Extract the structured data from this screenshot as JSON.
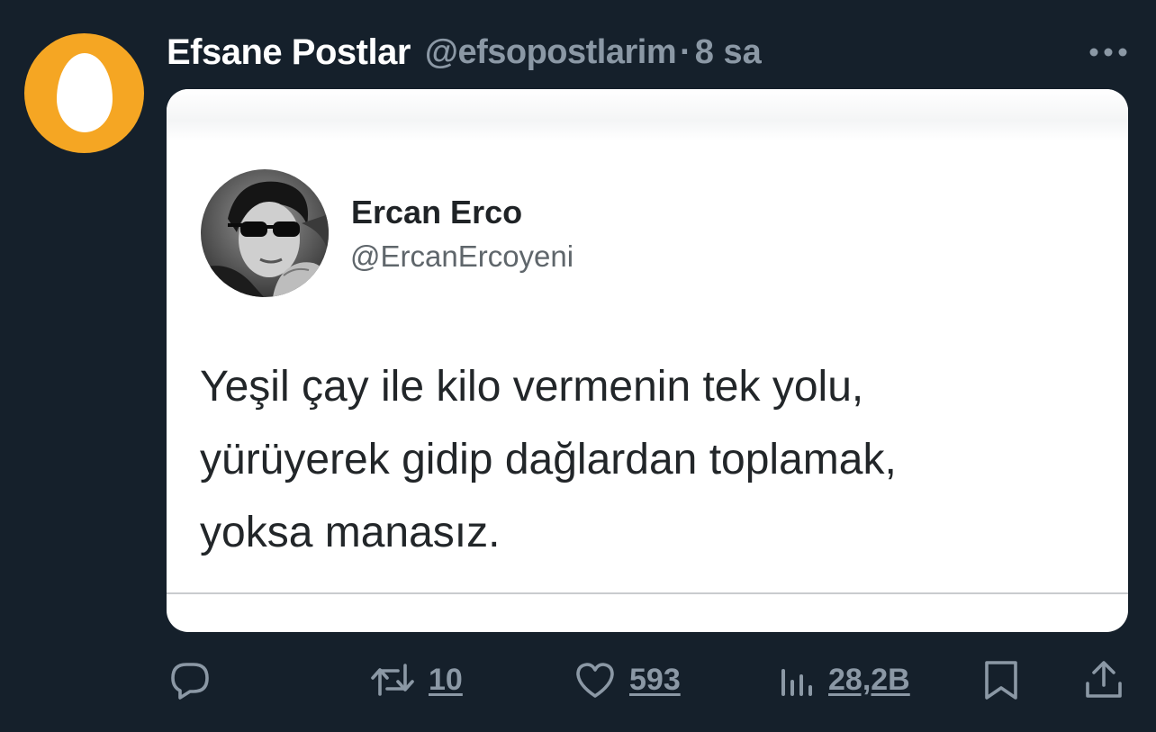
{
  "tweet": {
    "author": {
      "display_name": "Efsane Postlar",
      "handle": "@efsopostlarim",
      "separator": "·",
      "time": "8 sa"
    },
    "embedded_image": {
      "author_name": "Ercan Erco",
      "author_handle": "@ErcanErcoyeni",
      "text_lines": [
        "Yeşil çay ile kilo vermenin tek yolu,",
        "yürüyerek gidip dağlardan toplamak,",
        "yoksa manasız."
      ]
    },
    "actions": {
      "reply_count": "",
      "retweet_count": "10",
      "like_count": "593",
      "views_count": "28,2B"
    }
  },
  "icons": {
    "more": "more-horizontal-icon",
    "reply": "reply-icon",
    "retweet": "retweet-icon",
    "like": "heart-icon",
    "views": "views-chart-icon",
    "bookmark": "bookmark-icon",
    "share": "share-icon"
  },
  "colors": {
    "background": "#15202b",
    "secondary_text": "#8b98a5",
    "avatar_orange": "#f5a623"
  }
}
